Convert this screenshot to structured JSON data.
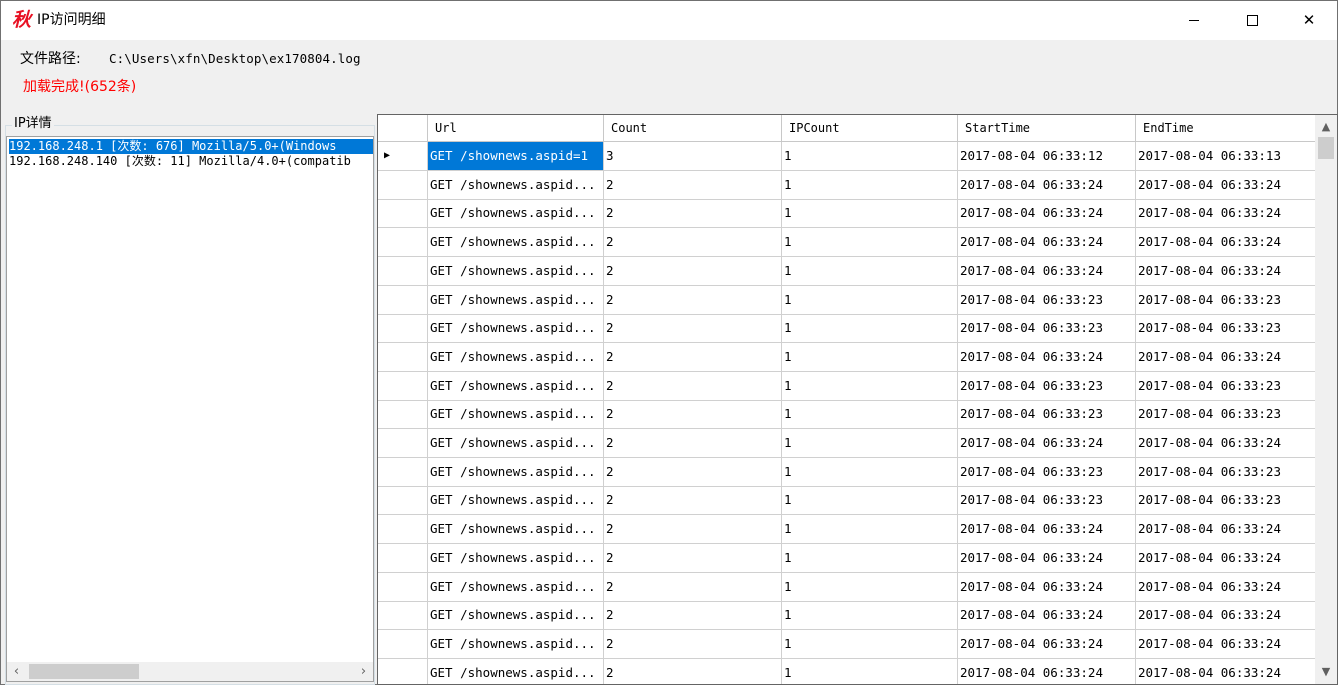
{
  "window": {
    "icon_glyph": "秋",
    "title": "IP访问明细",
    "accent_color": "#0078d7",
    "status_color": "#ff0000"
  },
  "file": {
    "label": "文件路径:",
    "path": "C:\\Users\\xfn\\Desktop\\ex170804.log"
  },
  "status": "加载完成!(652条)",
  "ip_panel": {
    "label": "IP详情",
    "items": [
      "192.168.248.1   [次数: 676] Mozilla/5.0+(Windows",
      "192.168.248.140 [次数: 11] Mozilla/4.0+(compatib"
    ]
  },
  "grid": {
    "columns": [
      "Url",
      "Count",
      "IPCount",
      "StartTime",
      "EndTime"
    ],
    "rows": [
      [
        "GET /shownews.aspid=1",
        "3",
        "1",
        "2017-08-04 06:33:12",
        "2017-08-04 06:33:13"
      ],
      [
        "GET /shownews.aspid...",
        "2",
        "1",
        "2017-08-04 06:33:24",
        "2017-08-04 06:33:24"
      ],
      [
        "GET /shownews.aspid...",
        "2",
        "1",
        "2017-08-04 06:33:24",
        "2017-08-04 06:33:24"
      ],
      [
        "GET /shownews.aspid...",
        "2",
        "1",
        "2017-08-04 06:33:24",
        "2017-08-04 06:33:24"
      ],
      [
        "GET /shownews.aspid...",
        "2",
        "1",
        "2017-08-04 06:33:24",
        "2017-08-04 06:33:24"
      ],
      [
        "GET /shownews.aspid...",
        "2",
        "1",
        "2017-08-04 06:33:23",
        "2017-08-04 06:33:23"
      ],
      [
        "GET /shownews.aspid...",
        "2",
        "1",
        "2017-08-04 06:33:23",
        "2017-08-04 06:33:23"
      ],
      [
        "GET /shownews.aspid...",
        "2",
        "1",
        "2017-08-04 06:33:24",
        "2017-08-04 06:33:24"
      ],
      [
        "GET /shownews.aspid...",
        "2",
        "1",
        "2017-08-04 06:33:23",
        "2017-08-04 06:33:23"
      ],
      [
        "GET /shownews.aspid...",
        "2",
        "1",
        "2017-08-04 06:33:23",
        "2017-08-04 06:33:23"
      ],
      [
        "GET /shownews.aspid...",
        "2",
        "1",
        "2017-08-04 06:33:24",
        "2017-08-04 06:33:24"
      ],
      [
        "GET /shownews.aspid...",
        "2",
        "1",
        "2017-08-04 06:33:23",
        "2017-08-04 06:33:23"
      ],
      [
        "GET /shownews.aspid...",
        "2",
        "1",
        "2017-08-04 06:33:23",
        "2017-08-04 06:33:23"
      ],
      [
        "GET /shownews.aspid...",
        "2",
        "1",
        "2017-08-04 06:33:24",
        "2017-08-04 06:33:24"
      ],
      [
        "GET /shownews.aspid...",
        "2",
        "1",
        "2017-08-04 06:33:24",
        "2017-08-04 06:33:24"
      ],
      [
        "GET /shownews.aspid...",
        "2",
        "1",
        "2017-08-04 06:33:24",
        "2017-08-04 06:33:24"
      ],
      [
        "GET /shownews.aspid...",
        "2",
        "1",
        "2017-08-04 06:33:24",
        "2017-08-04 06:33:24"
      ],
      [
        "GET /shownews.aspid...",
        "2",
        "1",
        "2017-08-04 06:33:24",
        "2017-08-04 06:33:24"
      ],
      [
        "GET /shownews.aspid...",
        "2",
        "1",
        "2017-08-04 06:33:24",
        "2017-08-04 06:33:24"
      ]
    ],
    "current_row_marker": "▶"
  },
  "icons": {
    "minimize": "minimize-icon",
    "maximize": "maximize-icon",
    "close": "close-icon",
    "close_glyph": "✕",
    "scroll_left": "‹",
    "scroll_right": "›",
    "scroll_up": "▲",
    "scroll_down": "▼"
  }
}
